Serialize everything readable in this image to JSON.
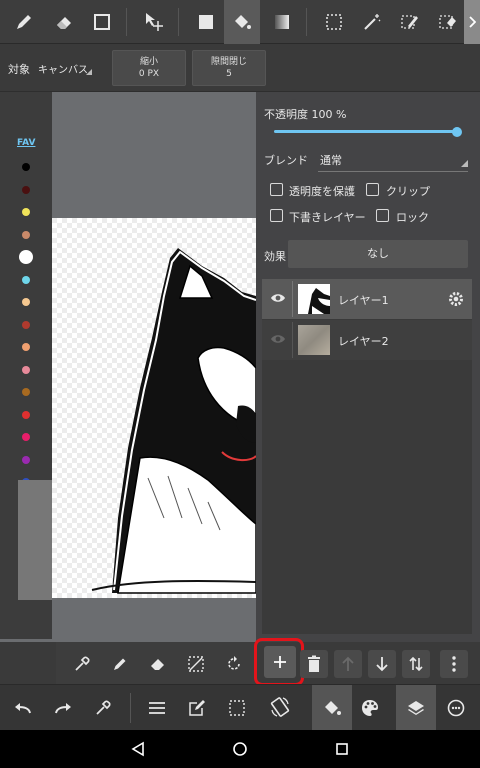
{
  "toolbar": {
    "icons": [
      "pen-icon",
      "eraser-icon",
      "rectangle-icon",
      "move-icon",
      "fill-rect-icon",
      "bucket-icon",
      "gradient-icon",
      "select-rect-icon",
      "magic-wand-icon",
      "select-pen-icon",
      "select-eraser-icon"
    ]
  },
  "subbar": {
    "target_label": "対象",
    "target_value": "キャンバス",
    "shrink_label": "縮小",
    "shrink_value": "0 PX",
    "gap_label": "隙間閉じ",
    "gap_value": "5"
  },
  "palette": {
    "fav_label": "FAV",
    "colors": [
      "#000000",
      "#4a1010",
      "#f0e35a",
      "#c98a6a",
      "#ffffff",
      "#6fd6ea",
      "#f5c890",
      "#b03a2e",
      "#f0a070",
      "#e88a9a",
      "#a86a20",
      "#e03030",
      "#e81e6a",
      "#9a2ab0",
      "#3050c0"
    ],
    "selected_index": 4
  },
  "layers_panel": {
    "opacity_label": "不透明度 100 %",
    "opacity_value": 1.0,
    "blend_label": "ブレンド",
    "blend_value": "通常",
    "protect_alpha_label": "透明度を保護",
    "clip_label": "クリップ",
    "draft_label": "下書きレイヤー",
    "lock_label": "ロック",
    "effect_label": "効果",
    "effect_value": "なし",
    "layers": [
      {
        "name": "レイヤー1",
        "visible": true,
        "selected": true
      },
      {
        "name": "レイヤー2",
        "visible": false,
        "selected": false
      }
    ]
  },
  "tool_row": {
    "icons": [
      "eyedropper-icon",
      "pen-icon",
      "eraser-icon",
      "deselect-icon",
      "rotate-icon",
      "add-layer-icon",
      "delete-layer-icon",
      "move-layer-up-icon",
      "move-layer-down-icon",
      "swap-layer-icon",
      "more-icon"
    ]
  },
  "main_row": {
    "icons": [
      "undo-icon",
      "redo-icon",
      "eyedropper-icon",
      "menu-icon",
      "edit-icon",
      "selection-icon",
      "rotate-screen-icon",
      "fill-icon",
      "palette-icon",
      "layers-icon",
      "brush-settings-icon"
    ]
  },
  "colors": {
    "accent": "#6fc6f2",
    "highlight": "#e3141b"
  }
}
